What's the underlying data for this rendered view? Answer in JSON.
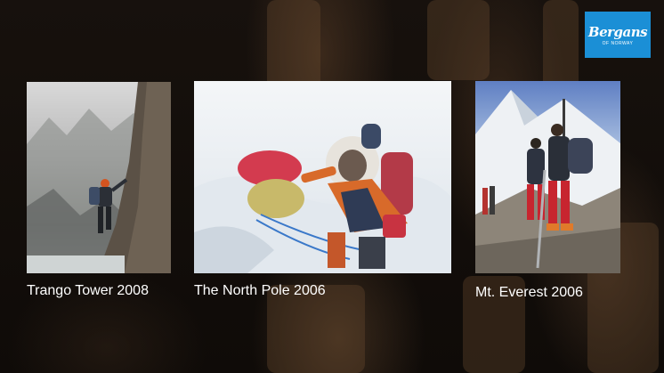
{
  "brand": {
    "name": "Bergans",
    "subtitle": "OF NORWAY",
    "color": "#1b8fd6"
  },
  "gallery": [
    {
      "caption": "Trango Tower 2008",
      "icon": "climber-on-rock-photo"
    },
    {
      "caption": "The North Pole 2006",
      "icon": "polar-explorer-photo"
    },
    {
      "caption": "Mt. Everest 2006",
      "icon": "everest-climbers-photo"
    }
  ]
}
